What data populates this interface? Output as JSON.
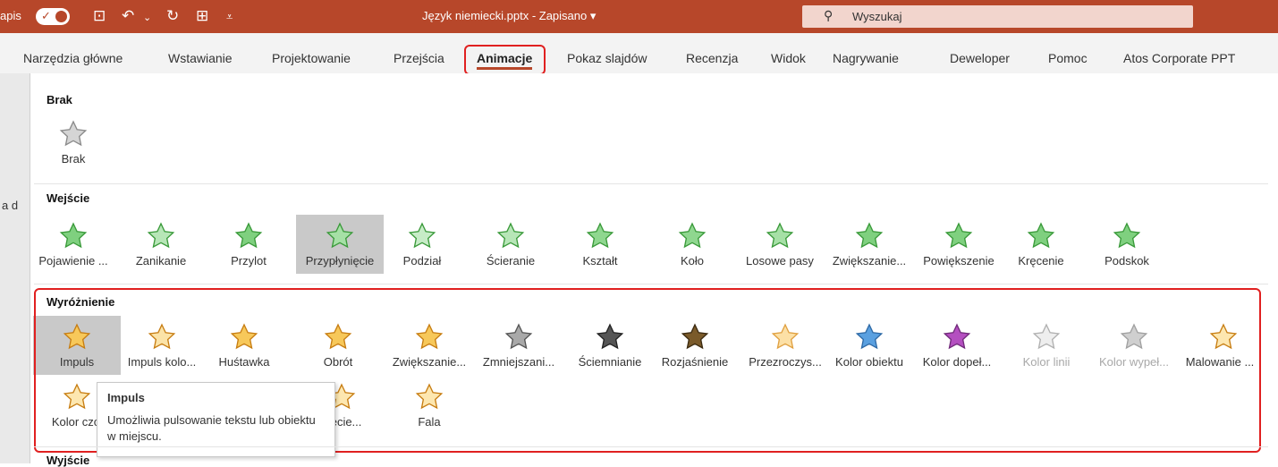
{
  "titlebar": {
    "autosave_label": "apis",
    "doc_title": "Język niemiecki.pptx - Zapisano ▾",
    "search_placeholder": "Wyszukaj"
  },
  "tabs": [
    "Narzędzia główne",
    "Wstawianie",
    "Projektowanie",
    "Przejścia",
    "Animacje",
    "Pokaz slajdów",
    "Recenzja",
    "Widok",
    "Nagrywanie",
    "Deweloper",
    "Pomoc",
    "Atos Corporate PPT"
  ],
  "active_tab": "Animacje",
  "sections": {
    "none": {
      "title": "Brak",
      "items": [
        "Brak"
      ]
    },
    "entrance": {
      "title": "Wejście",
      "items": [
        "Pojawienie ...",
        "Zanikanie",
        "Przylot",
        "Przypłynięcie",
        "Podział",
        "Ścieranie",
        "Kształt",
        "Koło",
        "Losowe pasy",
        "Zwiększanie...",
        "Powiększenie",
        "Kręcenie",
        "Podskok"
      ]
    },
    "emphasis": {
      "title": "Wyróżnienie",
      "row1": [
        "Impuls",
        "Impuls kolo...",
        "Huśtawka",
        "Obrót",
        "Zwiększanie...",
        "Zmniejszani...",
        "Ściemnianie",
        "Rozjaśnienie",
        "Przezroczys...",
        "Kolor obiektu",
        "Kolor dopeł...",
        "Kolor linii",
        "Kolor wypeł...",
        "Malowanie ..."
      ],
      "row2": [
        "Kolor czci",
        "nięcie...",
        "Fala"
      ]
    },
    "exit": {
      "title": "Wyjście"
    }
  },
  "tooltip": {
    "title": "Impuls",
    "description": "Umożliwia pulsowanie tekstu lub obiektu w miejscu."
  },
  "left_fragment": "a d",
  "colors": {
    "title_bar": "#b7472a",
    "entrance_star": "#5cb85c",
    "emphasis_star": "#f4b942",
    "highlight_red": "#e02020"
  }
}
